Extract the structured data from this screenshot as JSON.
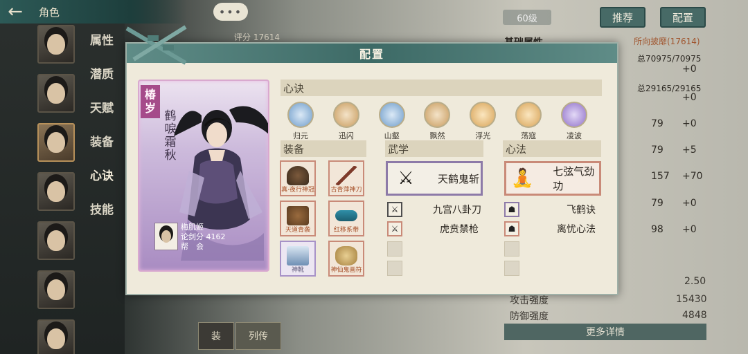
{
  "topbar": {
    "title": "角色"
  },
  "background": {
    "side_tabs": [
      "属性",
      "潜质",
      "天赋",
      "装备",
      "心诀",
      "技能"
    ],
    "score_prefix": "评分",
    "score": "17614",
    "level": "60级",
    "buttons": {
      "recommend": "推荐",
      "config": "配置"
    },
    "right_title": "基础属性",
    "right_sub": "所向披靡(17614)",
    "total_1": "总70975/70975",
    "total_2": "总29165/29165",
    "stat_values": [
      "79",
      "79",
      "157",
      "79",
      "98"
    ],
    "stat_plus": [
      "+0",
      "+0",
      "+0",
      "+5",
      "+70",
      "+0",
      "+0"
    ],
    "crit_value": "2.50",
    "attack_label": "攻击强度",
    "attack_value": "15430",
    "defense_label": "防御强度",
    "defense_value": "4848",
    "more_details": "更多详情",
    "liezhuan": "列传",
    "equip_mini": "装"
  },
  "modal": {
    "title": "配置",
    "character": {
      "rank": "椿岁",
      "title_vertical": "鹤唳霜秋",
      "name": "梅肌姬",
      "score_line": "论剑分 4162",
      "guild_line": "帮　会"
    },
    "sections": {
      "xinjue": "心诀",
      "equip": "装备",
      "wuxue": "武学",
      "xinfa": "心法"
    },
    "skills": [
      {
        "label": "归元",
        "color": "#6d9bc9"
      },
      {
        "label": "迅闪",
        "color": "#c79a5c"
      },
      {
        "label": "山壑",
        "color": "#6d9bc9"
      },
      {
        "label": "飘然",
        "color": "#c79a5c"
      },
      {
        "label": "浮光",
        "color": "#d7a256"
      },
      {
        "label": "荡寇",
        "color": "#d7a256"
      },
      {
        "label": "凌波",
        "color": "#8f6fc9"
      }
    ],
    "equipment": [
      {
        "name": "真·夜行神冠"
      },
      {
        "name": "古青萍神刀"
      },
      {
        "name": "天道青袭"
      },
      {
        "name": "红移系带"
      },
      {
        "name": "神靴"
      },
      {
        "name": "神仙鬼画符"
      }
    ],
    "wuxue": {
      "main": "天鹤鬼斩",
      "list": [
        "九宫八卦刀",
        "虎贲禁枪"
      ]
    },
    "xinfa": {
      "main": "七弦气劲功",
      "list": [
        "飞鹤诀",
        "离忧心法"
      ]
    }
  }
}
